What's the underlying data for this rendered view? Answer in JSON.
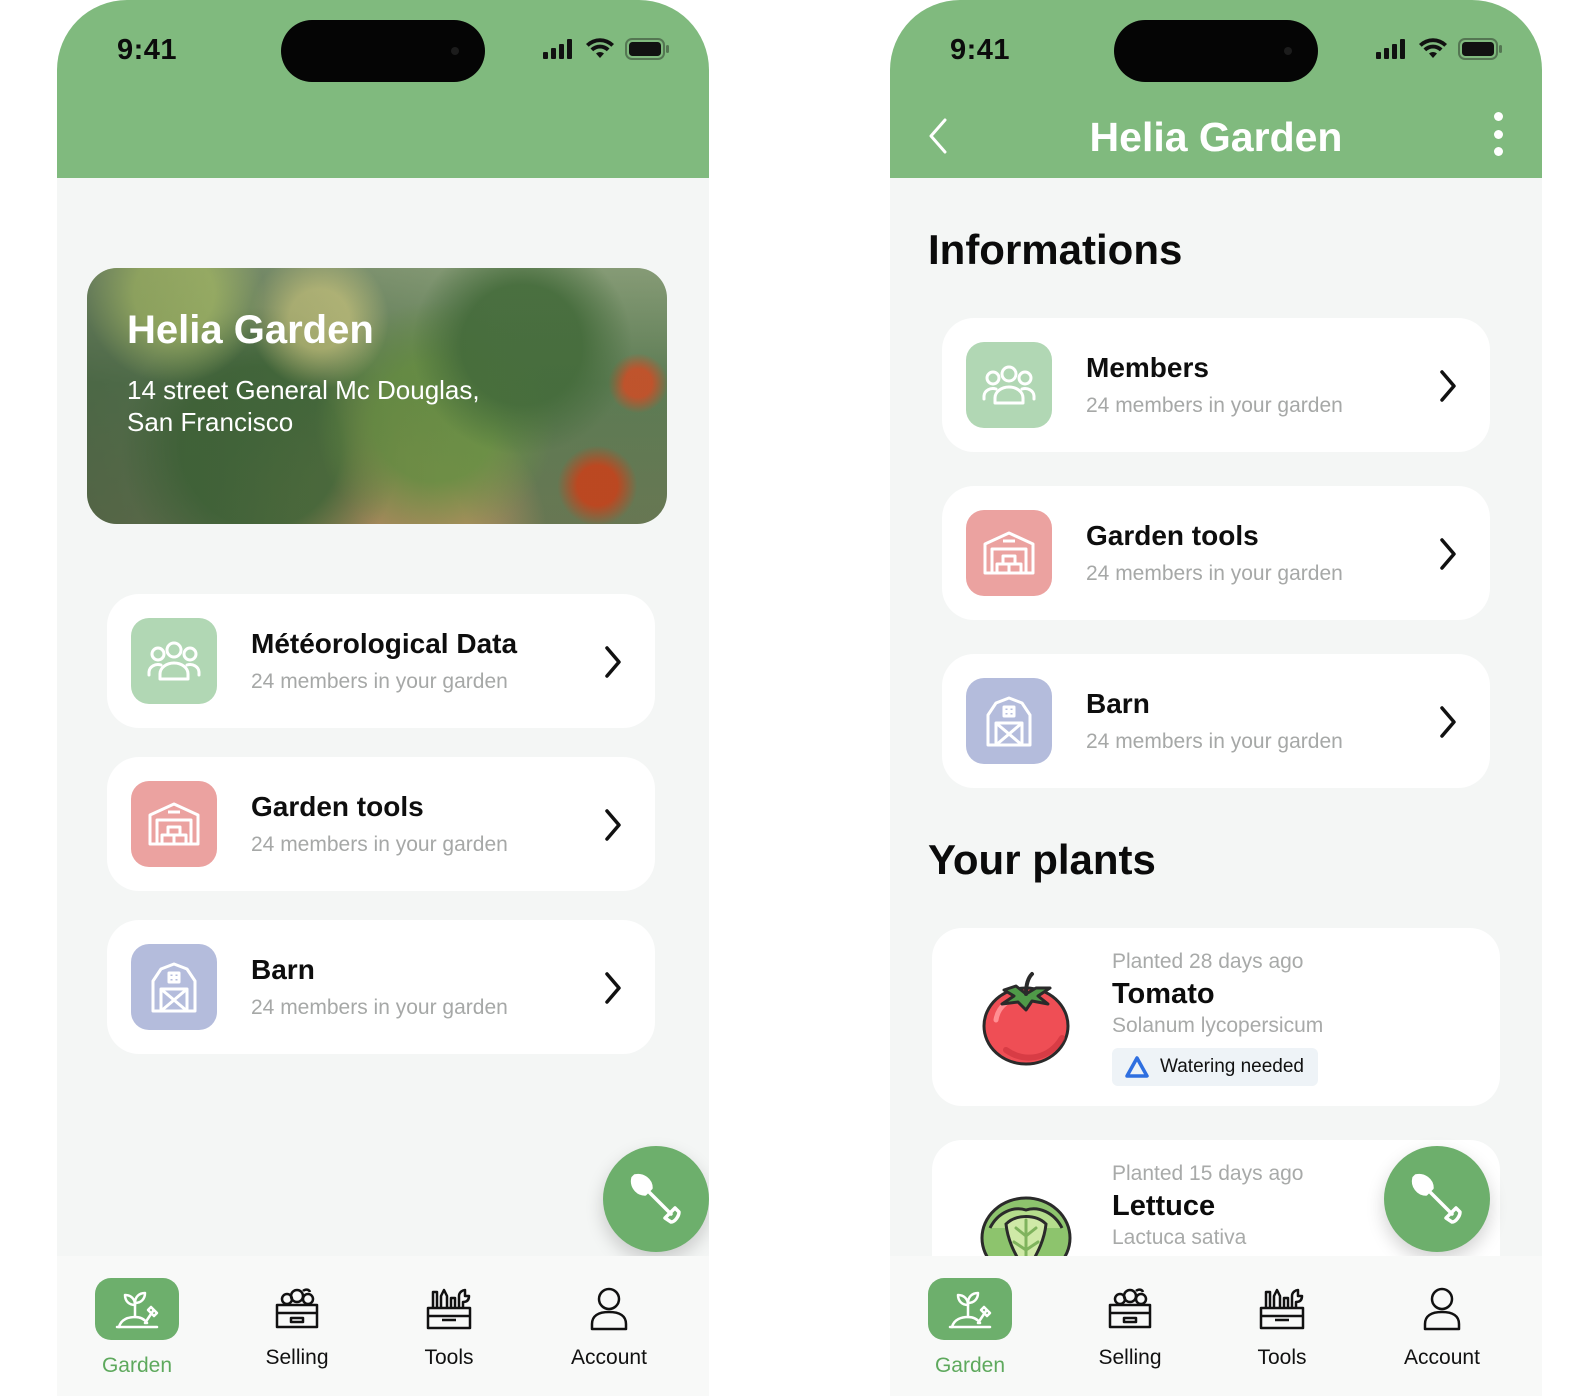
{
  "status_bar": {
    "time": "9:41"
  },
  "left_screen": {
    "hero": {
      "title": "Helia Garden",
      "address_line1": "14 street General Mc Douglas,",
      "address_line2": "San Francisco"
    },
    "cards": [
      {
        "title": "Météorological Data",
        "subtitle": "24 members in your garden",
        "icon": "members-icon",
        "color": "#b1d7b4"
      },
      {
        "title": "Garden tools",
        "subtitle": "24 members in your garden",
        "icon": "warehouse-icon",
        "color": "#eba2a0"
      },
      {
        "title": "Barn",
        "subtitle": "24 members in your garden",
        "icon": "barn-icon",
        "color": "#b4bcdc"
      }
    ]
  },
  "right_screen": {
    "header_title": "Helia Garden",
    "informations_title": "Informations",
    "cards": [
      {
        "title": "Members",
        "subtitle": "24 members in your garden",
        "icon": "members-icon",
        "color": "#b1d7b4"
      },
      {
        "title": "Garden tools",
        "subtitle": "24 members in your garden",
        "icon": "warehouse-icon",
        "color": "#eba2a0"
      },
      {
        "title": "Barn",
        "subtitle": "24 members in your garden",
        "icon": "barn-icon",
        "color": "#b4bcdc"
      }
    ],
    "plants_title": "Your plants",
    "plants": [
      {
        "planted": "Planted 28 days ago",
        "name": "Tomato",
        "latin": "Solanum lycopersicum",
        "badge": "Watering needed",
        "icon": "tomato-icon"
      },
      {
        "planted": "Planted 15 days ago",
        "name": "Lettuce",
        "latin": "Lactuca sativa",
        "icon": "lettuce-icon"
      }
    ]
  },
  "nav": {
    "items": [
      {
        "label": "Garden",
        "icon": "garden-icon",
        "active": true
      },
      {
        "label": "Selling",
        "icon": "selling-icon",
        "active": false
      },
      {
        "label": "Tools",
        "icon": "tools-icon",
        "active": false
      },
      {
        "label": "Account",
        "icon": "account-icon",
        "active": false
      }
    ]
  },
  "colors": {
    "header_green": "#80ba7e",
    "accent_green": "#6daf6c",
    "background": "#f4f6f5",
    "badge_blue": "#2f6fe0"
  }
}
